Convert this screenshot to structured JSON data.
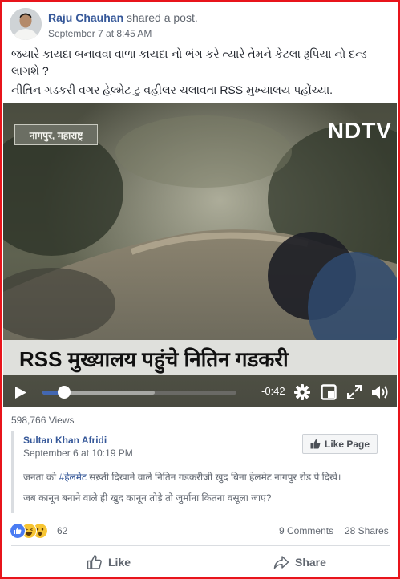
{
  "post": {
    "author": "Raju Chauhan",
    "action": "shared a post.",
    "timestamp": "September 7 at 8:45 AM",
    "text_line1": "જયારે કાયદા બનાવવા વાળા કાયદા નો ભંગ કરે ત્યારે તેમને કેટલા રૂપિયા નો દન્ડ",
    "text_line2": "લાગશે ?",
    "text_line3": "નીતિન ગડકરી વગર હેલ્મેટ ટુ વહીલર ચલાવતા RSS મુખ્યાલય પહોંચ્યા."
  },
  "video": {
    "location_tag": "नागपुर, महाराष्ट्र",
    "channel_logo": "NDTV",
    "banner_text": "RSS मुख्यालय पहुंचे नितिन गडकरी",
    "time_remaining": "-0:42",
    "progress_played": 0.11,
    "progress_buffered": 0.58,
    "views": "598,766 Views"
  },
  "shared": {
    "name": "Sultan Khan Afridi",
    "timestamp": "September 6 at 10:19 PM",
    "like_page_label": "Like Page",
    "line1_pre": "जनता को ",
    "hashtag": "#हेलमेट",
    "line1_post": " सख़्ती दिखाने वाले नितिन गडकरीजी खुद बिना हेलमेट नागपुर रोड पे दिखे।",
    "line2": "जब कानून बनाने वाले ही खुद कानून तोड़े तो जुर्माना कितना वसूला जाए?"
  },
  "stats": {
    "reaction_count": "62",
    "comments": "9 Comments",
    "shares": "28 Shares"
  },
  "actions": {
    "like_label": "Like",
    "share_label": "Share"
  },
  "colors": {
    "frame": "#e8141b",
    "link": "#365899",
    "progress": "#4267b2"
  },
  "icons": [
    "play-icon",
    "settings-gear-icon",
    "minimize-icon",
    "fullscreen-icon",
    "volume-icon",
    "like-page-thumb-icon",
    "like-reaction-icon",
    "haha-reaction-icon",
    "wow-reaction-icon",
    "like-thumb-icon",
    "share-arrow-icon"
  ]
}
